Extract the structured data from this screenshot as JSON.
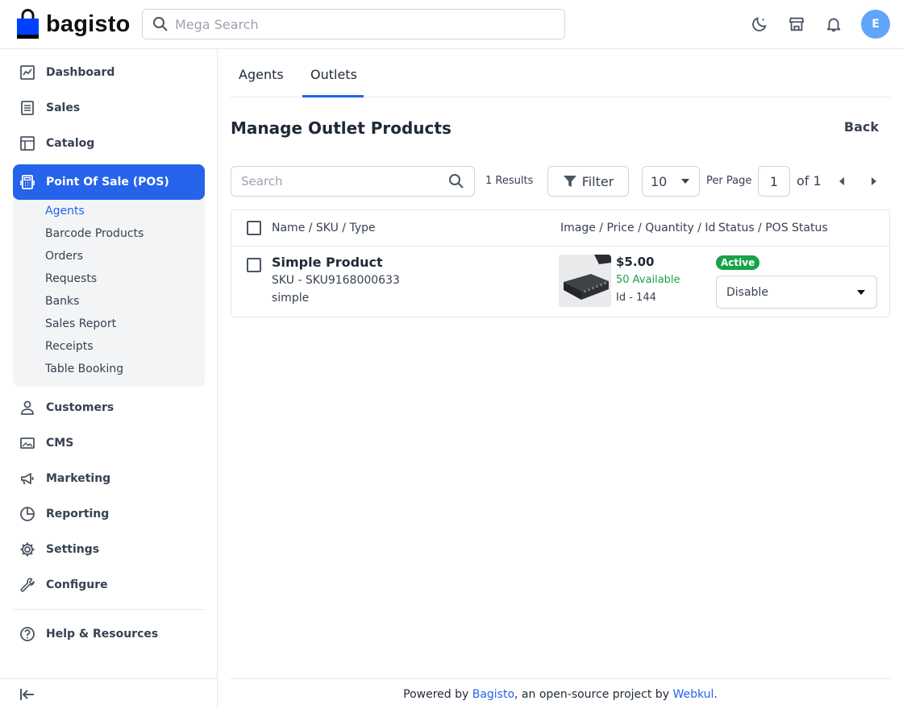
{
  "header": {
    "brand": "bagisto",
    "search_placeholder": "Mega Search",
    "avatar_initial": "E"
  },
  "sidebar": {
    "items": [
      {
        "label": "Dashboard",
        "icon": "dashboard-icon"
      },
      {
        "label": "Sales",
        "icon": "sales-icon"
      },
      {
        "label": "Catalog",
        "icon": "catalog-icon"
      },
      {
        "label": "Point Of Sale (POS)",
        "icon": "pos-icon",
        "active": true
      },
      {
        "label": "Customers",
        "icon": "customers-icon"
      },
      {
        "label": "CMS",
        "icon": "cms-icon"
      },
      {
        "label": "Marketing",
        "icon": "marketing-icon"
      },
      {
        "label": "Reporting",
        "icon": "reporting-icon"
      },
      {
        "label": "Settings",
        "icon": "settings-icon"
      },
      {
        "label": "Configure",
        "icon": "configure-icon"
      },
      {
        "label": "Help & Resources",
        "icon": "help-icon"
      }
    ],
    "pos_subitems": [
      "Agents",
      "Barcode Products",
      "Orders",
      "Requests",
      "Banks",
      "Sales Report",
      "Receipts",
      "Table Booking"
    ]
  },
  "tabs": [
    {
      "label": "Agents",
      "active": false
    },
    {
      "label": "Outlets",
      "active": true
    }
  ],
  "page": {
    "title": "Manage Outlet Products",
    "back_label": "Back"
  },
  "toolbar": {
    "search_placeholder": "Search",
    "results": "1 Results",
    "filter_label": "Filter",
    "per_page_value": "10",
    "per_page_label": "Per Page",
    "page_value": "1",
    "of_label": "of 1"
  },
  "table": {
    "headers": [
      "Name / SKU / Type",
      "Image / Price / Quantity / Id",
      "Status / POS Status"
    ],
    "rows": [
      {
        "name": "Simple Product",
        "sku": "SKU - SKU9168000633",
        "type": "simple",
        "price": "$5.00",
        "quantity": "50 Available",
        "id": "Id - 144",
        "status": "Active",
        "pos_status": "Disable"
      }
    ]
  },
  "footer": {
    "prefix": "Powered by ",
    "brand": "Bagisto",
    "middle": ", an open-source project by ",
    "company": "Webkul",
    "suffix": "."
  },
  "colors": {
    "accent": "#2563eb",
    "success": "#16a34a",
    "avatar": "#60a5fa"
  }
}
